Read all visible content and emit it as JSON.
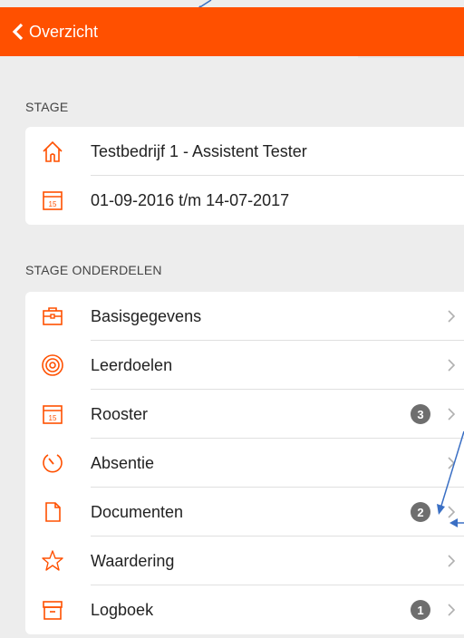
{
  "header": {
    "back_label": "Overzicht"
  },
  "stage": {
    "section_label": "STAGE",
    "company": "Testbedrijf 1 - Assistent Tester",
    "period": "01-09-2016 t/m 14-07-2017"
  },
  "onderdelen": {
    "section_label": "STAGE ONDERDELEN",
    "items": [
      {
        "label": "Basisgegevens",
        "badge": "",
        "icon": "briefcase-icon"
      },
      {
        "label": "Leerdoelen",
        "badge": "",
        "icon": "target-icon"
      },
      {
        "label": "Rooster",
        "badge": "3",
        "icon": "calendar-icon"
      },
      {
        "label": "Absentie",
        "badge": "",
        "icon": "timer-icon"
      },
      {
        "label": "Documenten",
        "badge": "2",
        "icon": "document-icon"
      },
      {
        "label": "Waardering",
        "badge": "",
        "icon": "star-icon"
      },
      {
        "label": "Logboek",
        "badge": "1",
        "icon": "archive-icon"
      }
    ]
  },
  "colors": {
    "accent": "#ff5000",
    "badge": "#6e6e6e",
    "annotation": "#3a6fc4"
  }
}
